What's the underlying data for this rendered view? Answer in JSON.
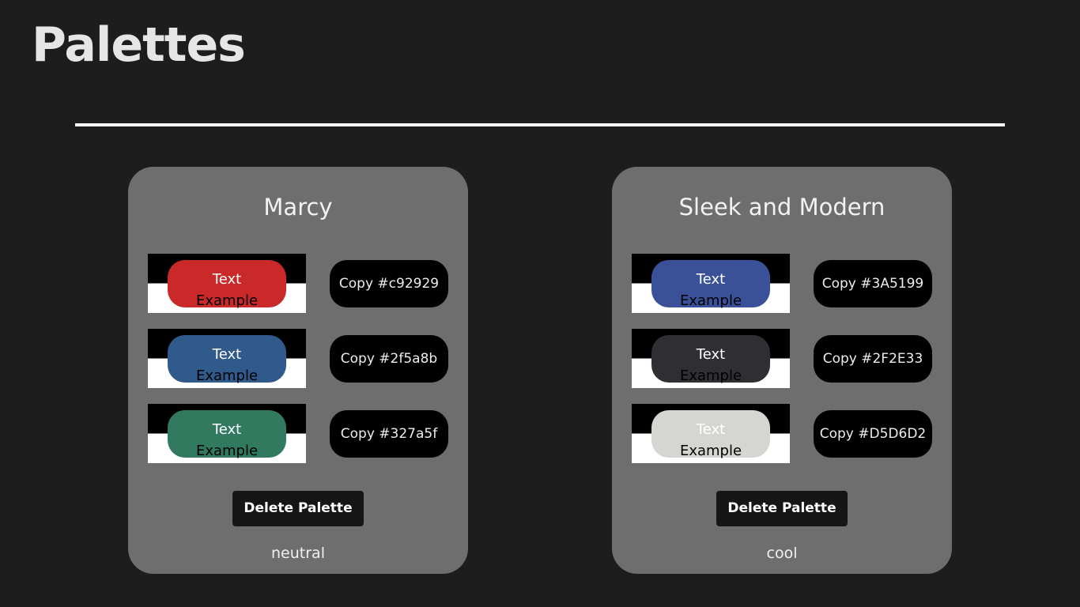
{
  "page": {
    "title": "Palettes"
  },
  "palettes": [
    {
      "name": "Marcy",
      "tag": "neutral",
      "delete_label": "Delete Palette",
      "swatches": [
        {
          "color": "#c92929",
          "text_top": "Text",
          "text_bottom": "Example",
          "copy_label": "Copy #c92929"
        },
        {
          "color": "#2f5a8b",
          "text_top": "Text",
          "text_bottom": "Example",
          "copy_label": "Copy #2f5a8b"
        },
        {
          "color": "#327a5f",
          "text_top": "Text",
          "text_bottom": "Example",
          "copy_label": "Copy #327a5f"
        }
      ]
    },
    {
      "name": "Sleek and Modern",
      "tag": "cool",
      "delete_label": "Delete Palette",
      "swatches": [
        {
          "color": "#3A5199",
          "text_top": "Text",
          "text_bottom": "Example",
          "copy_label": "Copy #3A5199"
        },
        {
          "color": "#2F2E33",
          "text_top": "Text",
          "text_bottom": "Example",
          "copy_label": "Copy #2F2E33"
        },
        {
          "color": "#D5D6D2",
          "text_top": "Text",
          "text_bottom": "Example",
          "copy_label": "Copy #D5D6D2"
        }
      ]
    }
  ]
}
